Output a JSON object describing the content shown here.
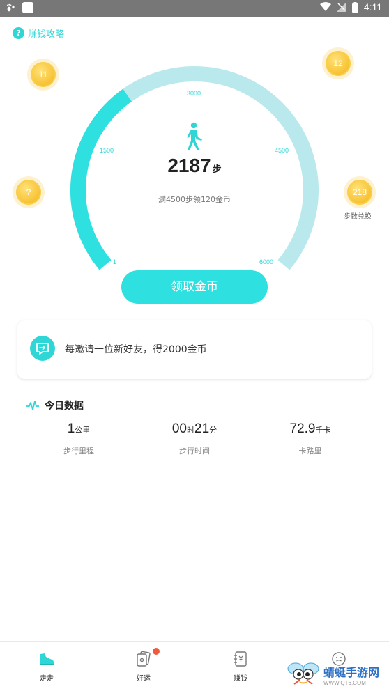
{
  "status_bar": {
    "time": "4:11"
  },
  "tips_link": {
    "label": "赚钱攻略",
    "icon": "question-icon"
  },
  "coins": [
    {
      "value": "11"
    },
    {
      "value": "12"
    },
    {
      "value": "?"
    },
    {
      "value": "218",
      "label": "步数兑换"
    }
  ],
  "gauge": {
    "ticks": [
      "1",
      "1500",
      "3000",
      "4500",
      "6000"
    ],
    "current": 2187,
    "max": 6000,
    "colors": {
      "progress": "#2fe0e0",
      "track": "#b9e9ec"
    }
  },
  "steps": {
    "value": "2187",
    "unit": "步"
  },
  "goal_text": "满4500步领120金币",
  "collect_button": {
    "label": "领取金币"
  },
  "invite": {
    "text": "每邀请一位新好友，得2000金币",
    "icon": "invite-icon"
  },
  "today": {
    "title": "今日数据",
    "stats": [
      {
        "value": "1",
        "unit": "公里",
        "label": "步行里程"
      },
      {
        "value_parts": [
          "00",
          "时",
          "21",
          "分"
        ],
        "label": "步行时间"
      },
      {
        "value": "72.9",
        "unit": "千卡",
        "label": "卡路里"
      }
    ]
  },
  "tabs": [
    {
      "label": "走走",
      "icon": "sneaker-icon",
      "active": true
    },
    {
      "label": "好运",
      "icon": "cards-icon",
      "badge": true
    },
    {
      "label": "赚钱",
      "icon": "notebook-yen-icon"
    },
    {
      "label": "",
      "icon": "face-icon"
    }
  ],
  "watermark": {
    "title": "蜻蜓手游网",
    "url": "WWW.QT6.COM"
  },
  "accent_color": "#2fd6d6"
}
